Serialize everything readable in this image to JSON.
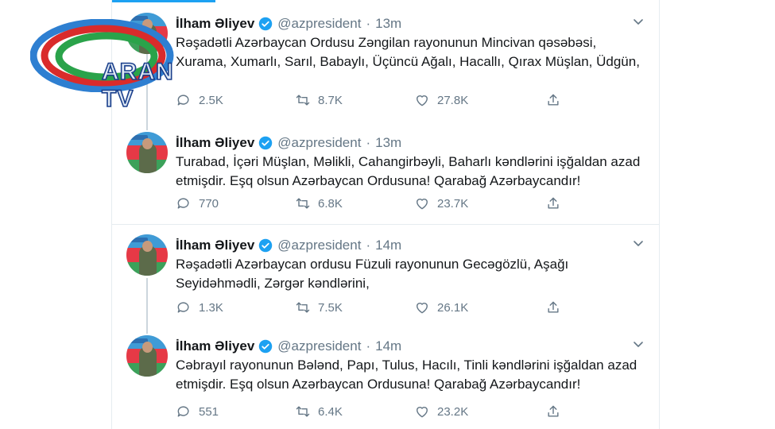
{
  "tweets": [
    {
      "name": "İlham Əliyev",
      "handle": "@azpresident",
      "time": "13m",
      "text": "Rəşadətli Azərbaycan Ordusu Zəngilan rayonunun Mincivan qəsəbəsi, Xurama, Xumarlı, Sarıl, Babaylı, Üçüncü Ağalı, Hacallı, Qırax Müşlan, Üdgün,",
      "replies": "2.5K",
      "retweets": "8.7K",
      "likes": "27.8K"
    },
    {
      "name": "İlham Əliyev",
      "handle": "@azpresident",
      "time": "13m",
      "text": "Turabad, İçəri Müşlan, Məlikli, Cahangirbəyli, Baharlı kəndlərini işğaldan azad etmişdir. Eşq olsun Azərbaycan Ordusuna! Qarabağ Azərbaycandır!",
      "replies": "770",
      "retweets": "6.8K",
      "likes": "23.7K"
    },
    {
      "name": "İlham Əliyev",
      "handle": "@azpresident",
      "time": "14m",
      "text": "Rəşadətli Azərbaycan ordusu Füzuli rayonunun Gecəgözlü, Aşağı Seyidəhmədli, Zərgər kəndlərini,",
      "replies": "1.3K",
      "retweets": "7.5K",
      "likes": "26.1K"
    },
    {
      "name": "İlham Əliyev",
      "handle": "@azpresident",
      "time": "14m",
      "text": "Cəbrayıl rayonunun Bələnd, Papı, Tulus, Hacılı, Tinli kəndlərini işğaldan azad etmişdir. Eşq olsun Azərbaycan Ordusuna! Qarabağ Azərbaycandır!",
      "replies": "551",
      "retweets": "6.4K",
      "likes": "23.2K"
    }
  ],
  "watermark": {
    "text": "ARAN TV"
  },
  "colors": {
    "accent": "#1da1f2",
    "secondary_text": "#657786",
    "verified": "#1da1f2"
  },
  "icons": [
    "verified-badge-icon",
    "chevron-down-icon",
    "reply-icon",
    "retweet-icon",
    "like-icon",
    "share-icon"
  ]
}
